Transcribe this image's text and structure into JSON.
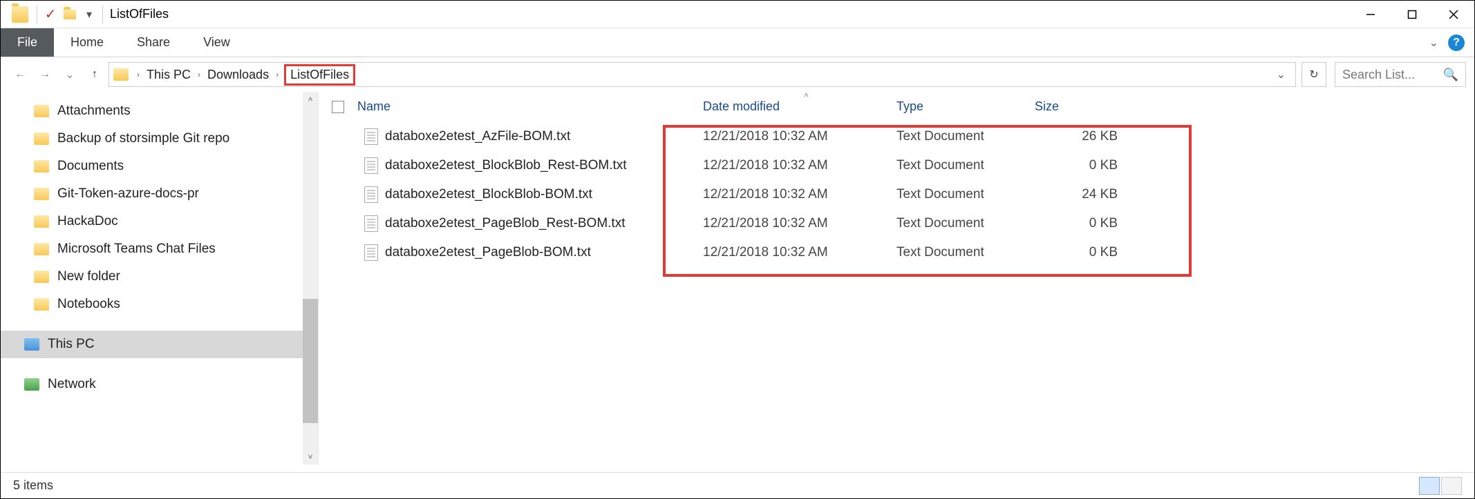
{
  "window": {
    "title": "ListOfFiles"
  },
  "ribbon": {
    "file": "File",
    "tabs": [
      "Home",
      "Share",
      "View"
    ]
  },
  "breadcrumb": {
    "items": [
      "This PC",
      "Downloads",
      "ListOfFiles"
    ],
    "highlighted_index": 2
  },
  "search": {
    "placeholder": "Search List..."
  },
  "sidebar": {
    "items": [
      {
        "label": "Attachments",
        "type": "folder"
      },
      {
        "label": "Backup of storsimple Git repo",
        "type": "folder"
      },
      {
        "label": "Documents",
        "type": "folder"
      },
      {
        "label": "Git-Token-azure-docs-pr",
        "type": "folder"
      },
      {
        "label": "HackaDoc",
        "type": "folder"
      },
      {
        "label": "Microsoft Teams Chat Files",
        "type": "folder"
      },
      {
        "label": "New folder",
        "type": "folder"
      },
      {
        "label": "Notebooks",
        "type": "folder"
      },
      {
        "label": "This PC",
        "type": "pc",
        "selected": true
      },
      {
        "label": "Network",
        "type": "network"
      }
    ]
  },
  "columns": {
    "name": "Name",
    "date": "Date modified",
    "type": "Type",
    "size": "Size"
  },
  "files": [
    {
      "name": "databoxe2etest_AzFile-BOM.txt",
      "date": "12/21/2018 10:32 AM",
      "type": "Text Document",
      "size": "26 KB"
    },
    {
      "name": "databoxe2etest_BlockBlob_Rest-BOM.txt",
      "date": "12/21/2018 10:32 AM",
      "type": "Text Document",
      "size": "0 KB"
    },
    {
      "name": "databoxe2etest_BlockBlob-BOM.txt",
      "date": "12/21/2018 10:32 AM",
      "type": "Text Document",
      "size": "24 KB"
    },
    {
      "name": "databoxe2etest_PageBlob_Rest-BOM.txt",
      "date": "12/21/2018 10:32 AM",
      "type": "Text Document",
      "size": "0 KB"
    },
    {
      "name": "databoxe2etest_PageBlob-BOM.txt",
      "date": "12/21/2018 10:32 AM",
      "type": "Text Document",
      "size": "0 KB"
    }
  ],
  "status": {
    "text": "5 items"
  }
}
